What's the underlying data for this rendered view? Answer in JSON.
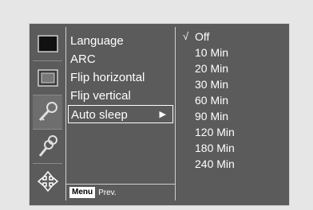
{
  "menu": {
    "items": [
      {
        "label": "Language"
      },
      {
        "label": "ARC"
      },
      {
        "label": "Flip horizontal"
      },
      {
        "label": "Flip vertical"
      },
      {
        "label": "Auto sleep",
        "arrow": "▶"
      }
    ],
    "help_key": "Menu",
    "help_text": "Prev."
  },
  "submenu": {
    "check_mark": "√",
    "items": [
      {
        "label": "Off"
      },
      {
        "label": "10 Min"
      },
      {
        "label": "20 Min"
      },
      {
        "label": "30 Min"
      },
      {
        "label": "60 Min"
      },
      {
        "label": "90 Min"
      },
      {
        "label": "120 Min"
      },
      {
        "label": "180 Min"
      },
      {
        "label": "240 Min"
      }
    ]
  },
  "icons": [
    "picture-icon",
    "screen-icon",
    "key-icon",
    "keys-icon",
    "move-icon"
  ]
}
